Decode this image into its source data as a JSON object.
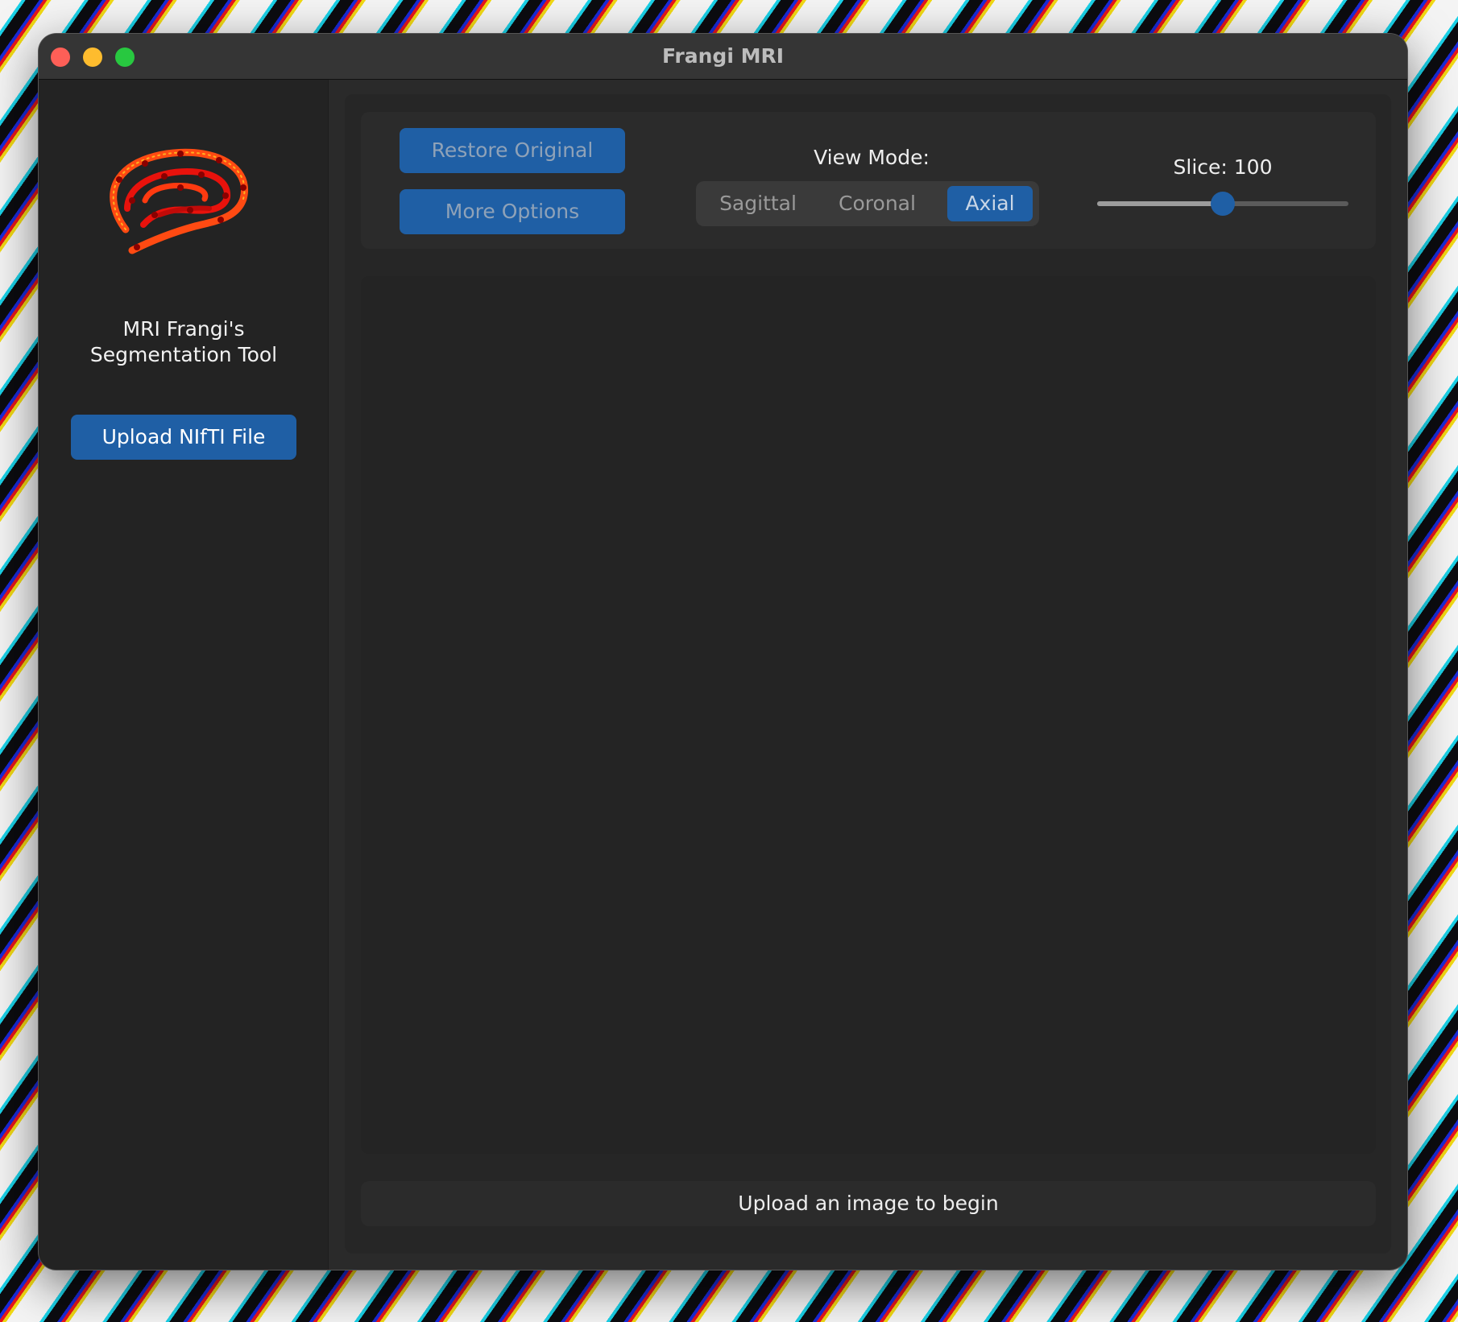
{
  "window": {
    "title": "Frangi MRI"
  },
  "sidebar": {
    "logo_icon": "brain-icon",
    "app_name_line1": "MRI Frangi's",
    "app_name_line2": "Segmentation Tool",
    "upload_label": "Upload NIfTI File"
  },
  "toolbar": {
    "restore_label": "Restore Original",
    "more_options_label": "More Options",
    "view_mode_label": "View Mode:",
    "view_modes": [
      "Sagittal",
      "Coronal",
      "Axial"
    ],
    "selected_view_mode": "Axial",
    "slice_label": "Slice: 100",
    "slice_position": 0.5
  },
  "status": {
    "message": "Upload an image to begin"
  },
  "colors": {
    "accent": "#1f5fa5",
    "window_bg": "#2a2a2a",
    "sidebar_bg": "#232323",
    "close": "#fe5f57",
    "minimize": "#febc2e",
    "maximize": "#28c840",
    "logo_primary": "#ff4a12"
  }
}
